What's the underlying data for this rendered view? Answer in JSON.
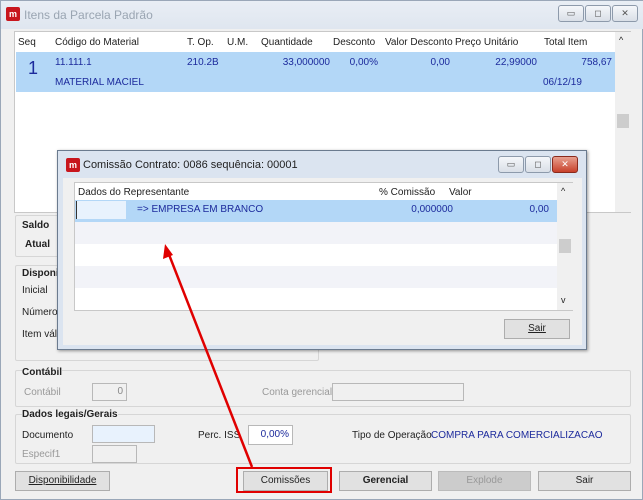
{
  "main_window": {
    "title": "Itens da Parcela Padrão",
    "icon": "app-logo-icon",
    "columns": [
      "Seq",
      "Código do Material",
      "T. Op.",
      "U.M.",
      "Quantidade",
      "Desconto",
      "Valor Desconto",
      "Preço Unitário",
      "Total Item"
    ],
    "rows": [
      {
        "seq": "1",
        "codigo": "11.111.1",
        "top": "210.2B",
        "um": "",
        "quantidade": "33,000000",
        "desconto": "0,00%",
        "valor_desconto": "0,00",
        "preco_unitario": "22,99000",
        "total_item": "758,67",
        "descricao": "MATERIAL MACIEL",
        "data": "06/12/19"
      }
    ],
    "saldo": {
      "title": "Saldo",
      "atual_label": "Atual"
    },
    "disponivel": {
      "title": "Disponi",
      "labels": [
        "Inicial",
        "Número d",
        "Item váli"
      ]
    },
    "contabil": {
      "title": "Contábil",
      "contabil_label": "Contábil",
      "contabil_value": "0",
      "conta_gerencial_label": "Conta gerencial",
      "conta_gerencial_value": ""
    },
    "dados_legais": {
      "title": "Dados legais/Gerais",
      "documento_label": "Documento",
      "documento_value": "",
      "perc_iss_label": "Perc. ISS",
      "perc_iss_value": "0,00%",
      "tipo_operacao_label": "Tipo de Operação",
      "tipo_operacao_value": "COMPRA PARA COMERCIALIZACAO",
      "especif_label": "Especif1",
      "especif_value": ""
    },
    "buttons": {
      "disponibilidade": "Disponibilidade",
      "comissoes": "Comissões",
      "gerencial": "Gerencial",
      "explode": "Explode",
      "sair": "Sair"
    }
  },
  "dialog": {
    "title": "Comissão Contrato: 0086 sequência: 00001",
    "columns": [
      "Dados do Representante",
      "% Comissão",
      "Valor"
    ],
    "rows": [
      {
        "codigo": "",
        "representante": "=> EMPRESA EM BRANCO",
        "comissao": "0,000000",
        "valor": "0,00"
      }
    ],
    "sair": "Sair"
  },
  "colors": {
    "selection": "#b3d7f7",
    "selected_text": "#1c2a9c",
    "highlight": "#e00000"
  }
}
